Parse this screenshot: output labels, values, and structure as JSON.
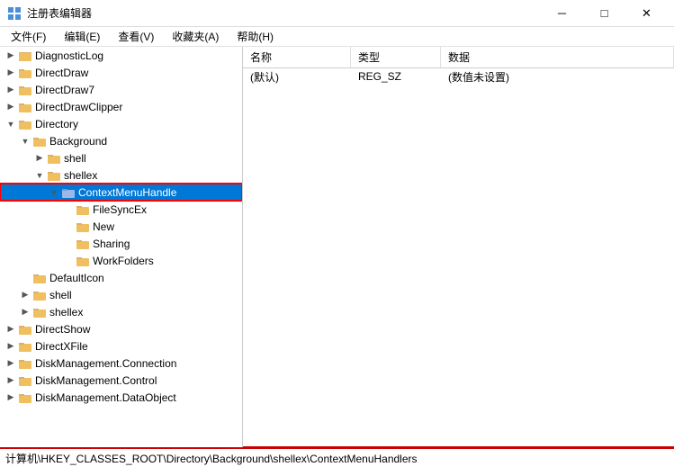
{
  "window": {
    "title": "注册表编辑器",
    "icon": "regedit"
  },
  "menu": {
    "items": [
      "文件(F)",
      "编辑(E)",
      "查看(V)",
      "收藏夹(A)",
      "帮助(H)"
    ]
  },
  "tree": {
    "nodes": [
      {
        "id": "diagnostic",
        "label": "DiagnosticLog",
        "level": 0,
        "expanded": false,
        "has_children": true
      },
      {
        "id": "directdraw",
        "label": "DirectDraw",
        "level": 0,
        "expanded": false,
        "has_children": true
      },
      {
        "id": "directdraw7",
        "label": "DirectDraw7",
        "level": 0,
        "expanded": false,
        "has_children": true
      },
      {
        "id": "directdrawclipper",
        "label": "DirectDrawClipper",
        "level": 0,
        "expanded": false,
        "has_children": true
      },
      {
        "id": "directory",
        "label": "Directory",
        "level": 0,
        "expanded": true,
        "has_children": true
      },
      {
        "id": "background",
        "label": "Background",
        "level": 1,
        "expanded": true,
        "has_children": true
      },
      {
        "id": "shell",
        "label": "shell",
        "level": 2,
        "expanded": false,
        "has_children": true
      },
      {
        "id": "shellex",
        "label": "shellex",
        "level": 2,
        "expanded": true,
        "has_children": true
      },
      {
        "id": "contextmenuhandle",
        "label": "ContextMenuHandle",
        "level": 3,
        "expanded": true,
        "has_children": true,
        "selected": true
      },
      {
        "id": "filesyncex",
        "label": "FileSyncEx",
        "level": 4,
        "expanded": false,
        "has_children": false
      },
      {
        "id": "new",
        "label": "New",
        "level": 4,
        "expanded": false,
        "has_children": false
      },
      {
        "id": "sharing",
        "label": "Sharing",
        "level": 4,
        "expanded": false,
        "has_children": false
      },
      {
        "id": "workfolders",
        "label": "WorkFolders",
        "level": 4,
        "expanded": false,
        "has_children": false
      },
      {
        "id": "defaulticon",
        "label": "DefaultIcon",
        "level": 1,
        "expanded": false,
        "has_children": false
      },
      {
        "id": "shell2",
        "label": "shell",
        "level": 1,
        "expanded": false,
        "has_children": true
      },
      {
        "id": "shellex2",
        "label": "shellex",
        "level": 1,
        "expanded": false,
        "has_children": true
      },
      {
        "id": "directshow",
        "label": "DirectShow",
        "level": 0,
        "expanded": false,
        "has_children": true
      },
      {
        "id": "directxfile",
        "label": "DirectXFile",
        "level": 0,
        "expanded": false,
        "has_children": true
      },
      {
        "id": "diskmanagement_connection",
        "label": "DiskManagement.Connection",
        "level": 0,
        "expanded": false,
        "has_children": true
      },
      {
        "id": "diskmanagement_control",
        "label": "DiskManagement.Control",
        "level": 0,
        "expanded": false,
        "has_children": true
      },
      {
        "id": "diskmanagement_dataobject",
        "label": "DiskManagement.DataObject",
        "level": 0,
        "expanded": false,
        "has_children": true
      }
    ]
  },
  "right_panel": {
    "columns": [
      "名称",
      "类型",
      "数据"
    ],
    "rows": [
      {
        "name": "(默认)",
        "type": "REG_SZ",
        "data": "(数值未设置)"
      }
    ]
  },
  "status_bar": {
    "path": "计算机\\HKEY_CLASSES_ROOT\\Directory\\Background\\shellex\\ContextMenuHandlers"
  }
}
